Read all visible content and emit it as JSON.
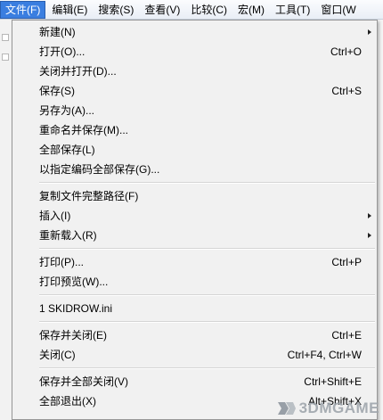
{
  "menubar": {
    "items": [
      {
        "label": "文件(F)",
        "active": true
      },
      {
        "label": "编辑(E)",
        "active": false
      },
      {
        "label": "搜索(S)",
        "active": false
      },
      {
        "label": "查看(V)",
        "active": false
      },
      {
        "label": "比较(C)",
        "active": false
      },
      {
        "label": "宏(M)",
        "active": false
      },
      {
        "label": "工具(T)",
        "active": false
      },
      {
        "label": "窗口(W",
        "active": false
      }
    ]
  },
  "file_menu": {
    "groups": [
      [
        {
          "label": "新建(N)",
          "shortcut": "",
          "submenu": true
        },
        {
          "label": "打开(O)...",
          "shortcut": "Ctrl+O",
          "submenu": false
        },
        {
          "label": "关闭并打开(D)...",
          "shortcut": "",
          "submenu": false
        },
        {
          "label": "保存(S)",
          "shortcut": "Ctrl+S",
          "submenu": false
        },
        {
          "label": "另存为(A)...",
          "shortcut": "",
          "submenu": false
        },
        {
          "label": "重命名并保存(M)...",
          "shortcut": "",
          "submenu": false
        },
        {
          "label": "全部保存(L)",
          "shortcut": "",
          "submenu": false
        },
        {
          "label": "以指定编码全部保存(G)...",
          "shortcut": "",
          "submenu": false
        }
      ],
      [
        {
          "label": "复制文件完整路径(F)",
          "shortcut": "",
          "submenu": false
        },
        {
          "label": "插入(I)",
          "shortcut": "",
          "submenu": true
        },
        {
          "label": "重新载入(R)",
          "shortcut": "",
          "submenu": true
        }
      ],
      [
        {
          "label": "打印(P)...",
          "shortcut": "Ctrl+P",
          "submenu": false
        },
        {
          "label": "打印预览(W)...",
          "shortcut": "",
          "submenu": false
        }
      ],
      [
        {
          "label": "1 SKIDROW.ini",
          "shortcut": "",
          "submenu": false
        }
      ],
      [
        {
          "label": "保存并关闭(E)",
          "shortcut": "Ctrl+E",
          "submenu": false
        },
        {
          "label": "关闭(C)",
          "shortcut": "Ctrl+F4, Ctrl+W",
          "submenu": false
        }
      ],
      [
        {
          "label": "保存并全部关闭(V)",
          "shortcut": "Ctrl+Shift+E",
          "submenu": false
        },
        {
          "label": "全部退出(X)",
          "shortcut": "Alt+Shift+X",
          "submenu": false
        }
      ]
    ]
  },
  "watermark": {
    "text": "3DMGAME"
  },
  "colors": {
    "menu_bg": "#f1f1f1",
    "active_menu": "#3a7ee0",
    "separator": "#d5d5d5"
  }
}
